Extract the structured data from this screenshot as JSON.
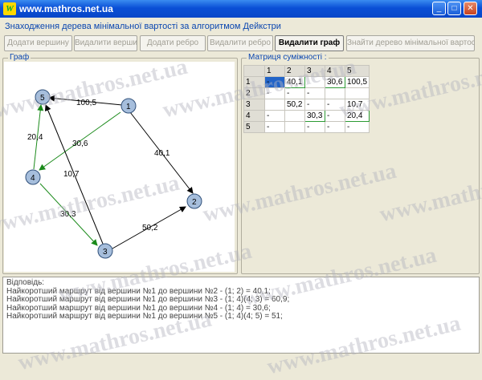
{
  "window": {
    "title": "www.mathros.net.ua",
    "icon_text": "W",
    "controls": [
      "_",
      "□",
      "✕"
    ]
  },
  "subtitle": "Знаходження дерева мінімальної вартості за алгоритмом Дейкстри",
  "toolbar": [
    {
      "label": "Додати вершину",
      "enabled": false
    },
    {
      "label": "Видалити вершину",
      "enabled": false
    },
    {
      "label": "Додати ребро",
      "enabled": false
    },
    {
      "label": "Видалити ребро",
      "enabled": false
    },
    {
      "label": "Видалити граф",
      "enabled": true
    },
    {
      "label": "Знайти дерево мінімальної вартості",
      "enabled": false
    }
  ],
  "graph_panel": {
    "label": "Граф",
    "vertices": [
      "1",
      "2",
      "3",
      "4",
      "5"
    ],
    "edge_labels": [
      "100,5",
      "30,6",
      "40,1",
      "20,4",
      "10,7",
      "30,3",
      "50,2"
    ]
  },
  "matrix_panel": {
    "label": "Матриця суміжності :",
    "header": [
      "",
      "1",
      "2",
      "3",
      "4",
      "5"
    ],
    "rows": [
      [
        "1",
        "-",
        "40,1",
        "",
        "30,6",
        "100,5"
      ],
      [
        "2",
        "-",
        "-",
        "-",
        "",
        ""
      ],
      [
        "3",
        "",
        "50,2",
        "-",
        "-",
        "10,7"
      ],
      [
        "4",
        "-",
        "",
        "30,3",
        "-",
        "20,4"
      ],
      [
        "5",
        "-",
        "",
        "-",
        "-",
        "-"
      ]
    ]
  },
  "answer": {
    "label": "Відповідь:",
    "lines": [
      "Найкоротший маршрут від вершини №1 до вершини №2 - (1; 2) = 40,1;",
      "Найкоротший маршрут від вершини №1 до вершини №3 - (1; 4)(4; 3) = 60,9;",
      "Найкоротший маршрут від вершини №1 до вершини №4 - (1; 4) = 30,6;",
      "Найкоротший маршрут від вершини №1 до вершини №5 - (1; 4)(4; 5) = 51;"
    ]
  },
  "watermark": "www.mathros.net.ua",
  "colors": {
    "tree_edge": "#1a8a1a",
    "edge": "#000000",
    "vertex_fill": "#a6bedc",
    "selection": "#2264c8",
    "title_blue": "#0a46b0"
  }
}
